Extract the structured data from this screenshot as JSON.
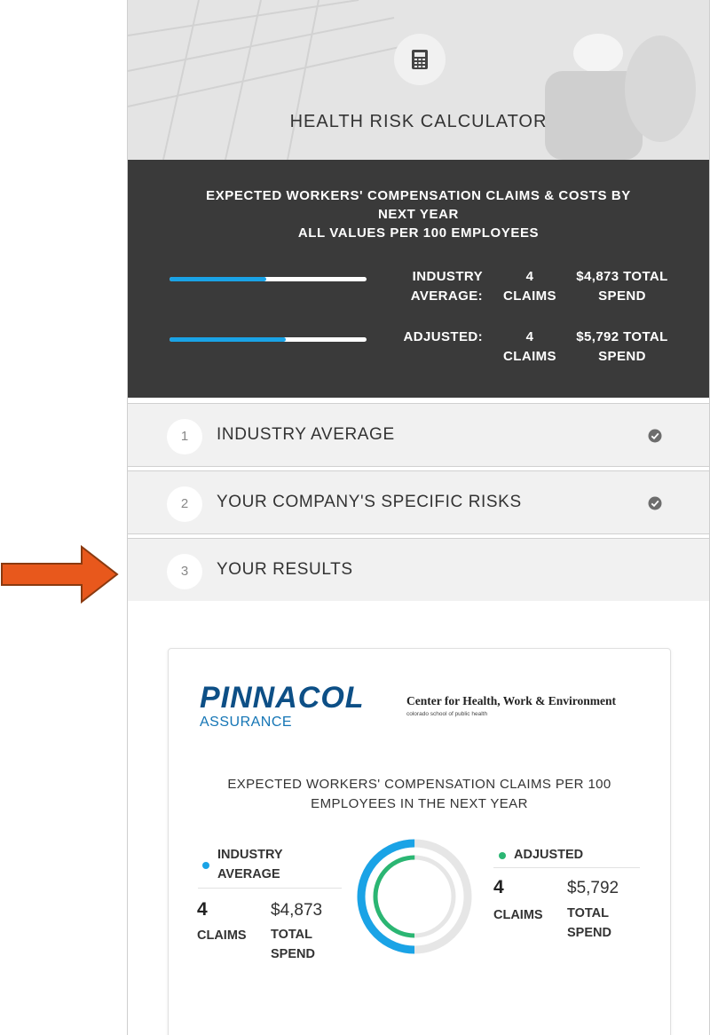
{
  "header": {
    "title": "HEALTH RISK CALCULATOR",
    "icon": "calculator-icon"
  },
  "summary": {
    "title_line1": "EXPECTED WORKERS' COMPENSATION CLAIMS & COSTS BY",
    "title_line2": "NEXT YEAR",
    "title_line3": "ALL VALUES PER 100 EMPLOYEES",
    "rows": [
      {
        "label_line1": "INDUSTRY",
        "label_line2": "AVERAGE:",
        "claims_count": "4",
        "claims_word": "CLAIMS",
        "spend_amount": "$4,873 TOTAL",
        "spend_word": "SPEND",
        "bar_fraction": 0.49
      },
      {
        "label_line1": "ADJUSTED:",
        "label_line2": "",
        "claims_count": "4",
        "claims_word": "CLAIMS",
        "spend_amount": "$5,792 TOTAL",
        "spend_word": "SPEND",
        "bar_fraction": 0.59
      }
    ],
    "colors": {
      "bar_fill": "#1aa3e6",
      "bar_track": "#ffffff",
      "background": "#3a3a3a"
    }
  },
  "steps": [
    {
      "number": "1",
      "label": "INDUSTRY AVERAGE",
      "completed": true
    },
    {
      "number": "2",
      "label": "YOUR COMPANY'S SPECIFIC RISKS",
      "completed": true
    },
    {
      "number": "3",
      "label": "YOUR RESULTS",
      "completed": false
    }
  ],
  "results": {
    "logo_main": "PINNACOL",
    "logo_sub": "ASSURANCE",
    "partner_name": "Center for Health, Work & Environment",
    "partner_sub": "colorado school of public health",
    "title_line1": "EXPECTED WORKERS' COMPENSATION CLAIMS PER 100",
    "title_line2": "EMPLOYEES IN THE NEXT YEAR",
    "industry": {
      "label_line1": "INDUSTRY",
      "label_line2": "AVERAGE",
      "claims": "4",
      "claims_label": "CLAIMS",
      "spend": "$4,873",
      "spend_label_line1": "TOTAL",
      "spend_label_line2": "SPEND",
      "color": "#1aa3e6",
      "ring_fraction": 0.5
    },
    "adjusted": {
      "label": "ADJUSTED",
      "claims": "4",
      "claims_label": "CLAIMS",
      "spend": "$5,792",
      "spend_label_line1": "TOTAL",
      "spend_label_line2": "SPEND",
      "color": "#2bb673",
      "ring_fraction": 0.5
    }
  },
  "colors": {
    "arrow": "#e8581c",
    "accent_blue": "#1aa3e6",
    "accent_green": "#2bb673",
    "logo_navy": "#0d4f86"
  }
}
